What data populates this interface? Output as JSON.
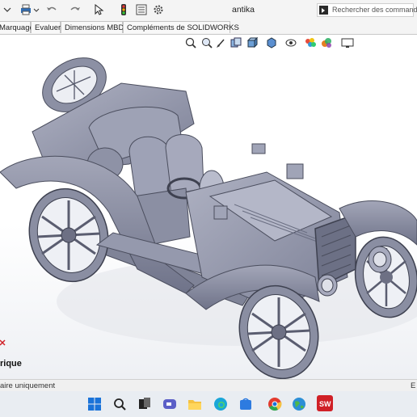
{
  "window": {
    "title": "antika"
  },
  "search": {
    "placeholder": "Rechercher des commandes"
  },
  "tabs": [
    "Marquage",
    "Evaluer",
    "Dimensions MBD",
    "Compléments de SOLIDWORKS"
  ],
  "viewport": {
    "partial_label": "rique"
  },
  "status": {
    "text": "aire uniquement",
    "right": "E"
  },
  "icons": [
    "dropdown-arrow-icon",
    "print-icon",
    "undo-icon",
    "redo-icon",
    "select-cursor-icon",
    "traffic-light-icon",
    "file-properties-icon",
    "gear-icon",
    "search-command-icon"
  ],
  "colors": {
    "model": "#9296a8",
    "background": "#ffffff",
    "taskbar": "#e9edf2",
    "solidworks_red": "#d02027"
  }
}
